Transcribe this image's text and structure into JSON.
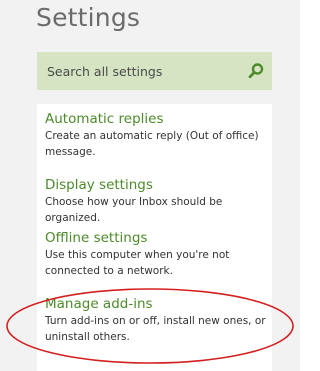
{
  "page": {
    "title": "Settings"
  },
  "search": {
    "placeholder": "Search all settings"
  },
  "settings": [
    {
      "title": "Automatic replies",
      "description": "Create an automatic reply (Out of office) message."
    },
    {
      "title": "Display settings",
      "description": "Choose how your Inbox should be organized."
    },
    {
      "title": "Offline settings",
      "description": "Use this computer when you're not connected to a network."
    },
    {
      "title": "Manage add-ins",
      "description": "Turn add-ins on or off, install new ones, or uninstall others."
    }
  ],
  "colors": {
    "accent": "#4d8a2a",
    "search_bg": "#d6e4c4",
    "highlight": "#d42020"
  }
}
